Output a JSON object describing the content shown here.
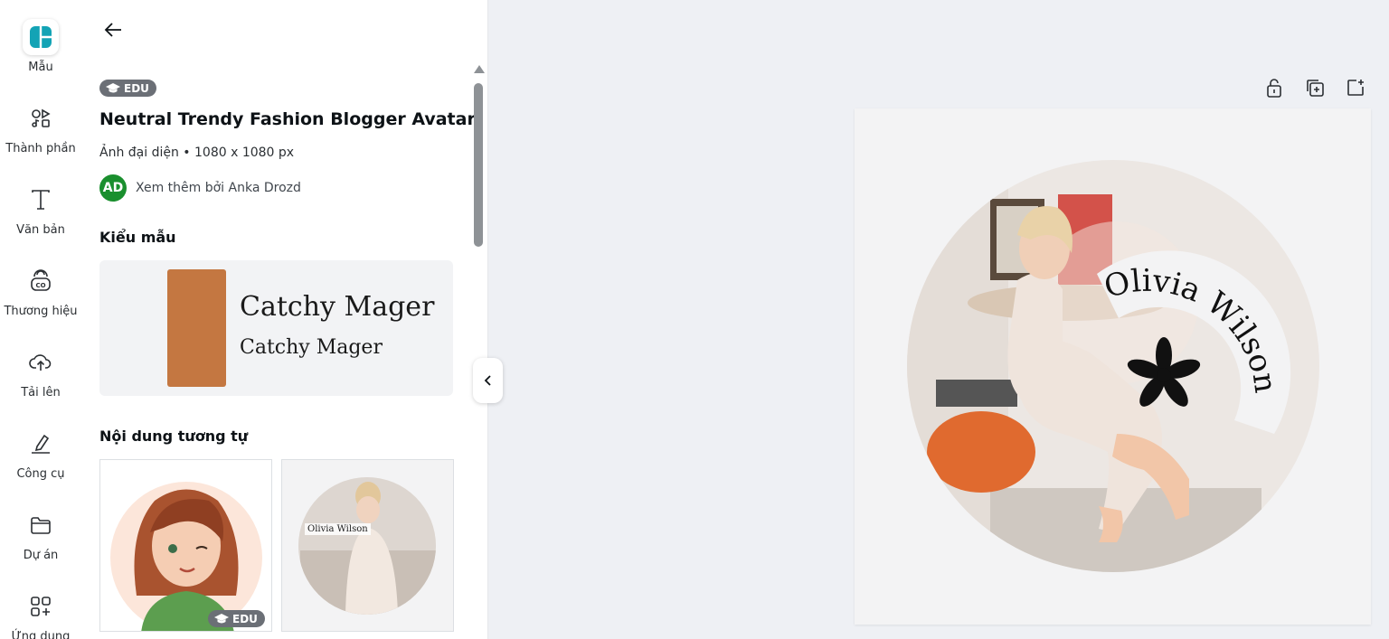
{
  "rail": {
    "items": [
      {
        "label": "Mẫu",
        "icon": "templates-icon"
      },
      {
        "label": "Thành phần",
        "icon": "elements-icon"
      },
      {
        "label": "Văn bản",
        "icon": "text-icon"
      },
      {
        "label": "Thương hiệu",
        "icon": "brand-icon"
      },
      {
        "label": "Tải lên",
        "icon": "upload-icon"
      },
      {
        "label": "Công cụ",
        "icon": "draw-icon"
      },
      {
        "label": "Dự án",
        "icon": "folder-icon"
      },
      {
        "label": "Ứng dụng",
        "icon": "apps-icon"
      }
    ]
  },
  "panel": {
    "badge": "EDU",
    "title": "Neutral Trendy Fashion Blogger Avatar",
    "subtitle": "Ảnh đại diện • 1080 x 1080 px",
    "author_initials": "AD",
    "author_text": "Xem thêm bởi Anka Drozd",
    "style_heading": "Kiểu mẫu",
    "style_font_sample_1": "Catchy Mager",
    "style_font_sample_2": "Catchy Mager",
    "style_swatch_color": "#c47741",
    "similar_heading": "Nội dung tương tự",
    "thumb1_badge": "EDU",
    "thumb2_caption": "Olivia Wilson"
  },
  "canvas": {
    "curved_text": "Olivia Wilson"
  },
  "colors": {
    "accent_teal": "#13a3b5",
    "avatar_green": "#1a8f2e",
    "badge_gray": "#6b6f76"
  }
}
